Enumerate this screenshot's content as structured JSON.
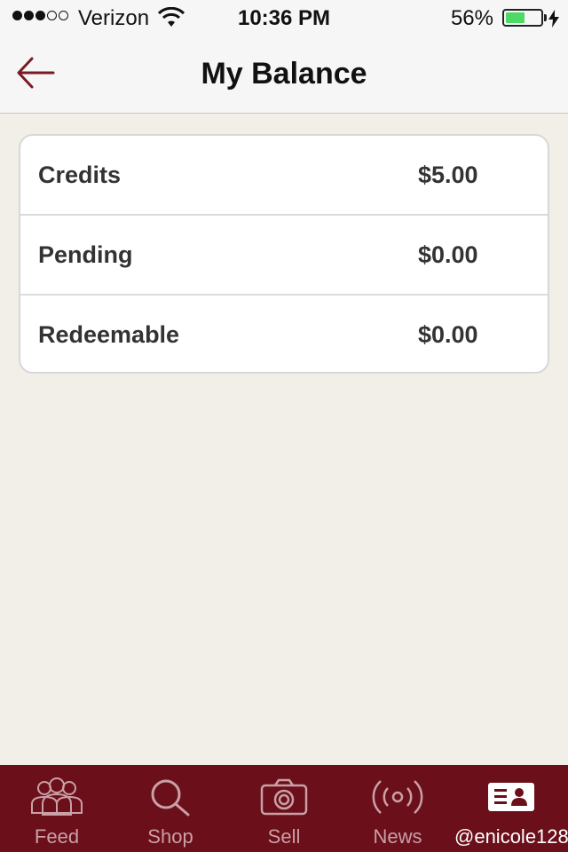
{
  "status_bar": {
    "carrier": "Verizon",
    "time": "10:36 PM",
    "battery_percent": "56%",
    "battery_level": 0.56,
    "signal_bars_filled": 3,
    "signal_bars_total": 5
  },
  "nav": {
    "title": "My Balance",
    "back_icon": "arrow-left-icon"
  },
  "balances": [
    {
      "label": "Credits",
      "value": "$5.00"
    },
    {
      "label": "Pending",
      "value": "$0.00"
    },
    {
      "label": "Redeemable",
      "value": "$0.00"
    }
  ],
  "tabs": [
    {
      "label": "Feed",
      "icon": "people-icon"
    },
    {
      "label": "Shop",
      "icon": "search-icon"
    },
    {
      "label": "Sell",
      "icon": "camera-icon"
    },
    {
      "label": "News",
      "icon": "broadcast-icon"
    },
    {
      "label": "@enicole128",
      "icon": "profile-card-icon",
      "active": true
    }
  ],
  "colors": {
    "accent": "#6b0f1a",
    "battery": "#4cd964",
    "background": "#f2efe9"
  }
}
